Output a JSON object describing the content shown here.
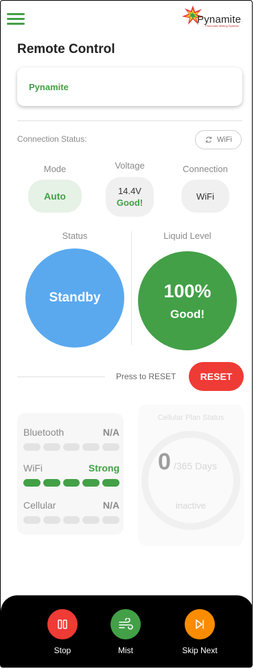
{
  "app": {
    "logo_text": "Pynamite",
    "logo_tagline": "Pneumatic Misting Systems"
  },
  "page_title": "Remote Control",
  "device": {
    "name": "Pynamite"
  },
  "connection": {
    "label": "Connection Status:",
    "refresh_label": "WiFi"
  },
  "stats": {
    "mode": {
      "label": "Mode",
      "value": "Auto"
    },
    "voltage": {
      "label": "Voltage",
      "value": "14.4V",
      "status": "Good!"
    },
    "connection": {
      "label": "Connection",
      "value": "WiFi"
    }
  },
  "status": {
    "label": "Status",
    "value": "Standby",
    "color": "#5aa9ef"
  },
  "liquid": {
    "label": "Liquid Level",
    "value": "100%",
    "status": "Good!",
    "color": "#43a047"
  },
  "reset": {
    "hint": "Press to RESET",
    "button_label": "RESET",
    "color": "#ef3b35"
  },
  "signals": [
    {
      "name": "Bluetooth",
      "value": "N/A",
      "bars_filled": 0,
      "bars_total": 5
    },
    {
      "name": "WiFi",
      "value": "Strong",
      "bars_filled": 5,
      "bars_total": 5
    },
    {
      "name": "Cellular",
      "value": "N/A",
      "bars_filled": 0,
      "bars_total": 5
    }
  ],
  "cellular_plan": {
    "title": "Cellular Plan Status",
    "days_used": "0",
    "days_total": "/365 Days",
    "status": "inactive"
  },
  "actions": [
    {
      "label": "Stop",
      "icon": "pause-icon",
      "color": "#ef3b35"
    },
    {
      "label": "Mist",
      "icon": "wind-icon",
      "color": "#43a047"
    },
    {
      "label": "Skip Next",
      "icon": "skip-next-icon",
      "color": "#fb8c00"
    }
  ]
}
